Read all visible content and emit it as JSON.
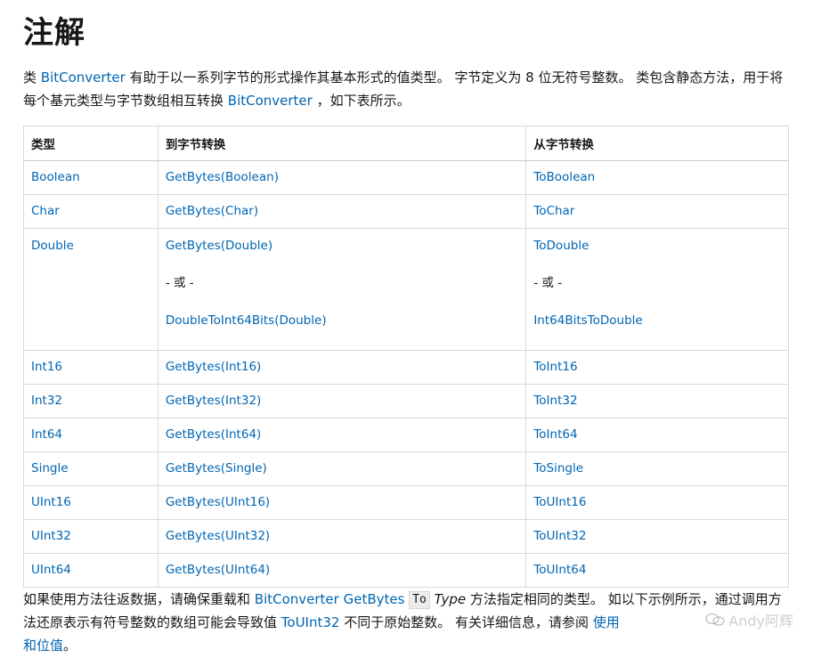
{
  "heading": "注解",
  "intro": {
    "t1": "类 ",
    "link1": "BitConverter",
    "t2": " 有助于以一系列字节的形式操作其基本形式的值类型。 字节定义为 8 位无符号整数。 类包含静态方法，用于将每个基元类型与字节数组相互转换 ",
    "link2": "BitConverter",
    "t3": " ，如下表所示。"
  },
  "table": {
    "headers": [
      "类型",
      "到字节转换",
      "从字节转换"
    ],
    "rows": [
      {
        "type": "Boolean",
        "to": "GetBytes(Boolean)",
        "from": "ToBoolean"
      },
      {
        "type": "Char",
        "to": "GetBytes(Char)",
        "from": "ToChar"
      },
      {
        "type": "Double",
        "to": "GetBytes(Double)",
        "or_to": "- 或 -",
        "to2": "DoubleToInt64Bits(Double)",
        "from": "ToDouble",
        "or_from": "- 或 -",
        "from2": "Int64BitsToDouble"
      },
      {
        "type": "Int16",
        "to": "GetBytes(Int16)",
        "from": "ToInt16"
      },
      {
        "type": "Int32",
        "to": "GetBytes(Int32)",
        "from": "ToInt32"
      },
      {
        "type": "Int64",
        "to": "GetBytes(Int64)",
        "from": "ToInt64"
      },
      {
        "type": "Single",
        "to": "GetBytes(Single)",
        "from": "ToSingle"
      },
      {
        "type": "UInt16",
        "to": "GetBytes(UInt16)",
        "from": "ToUInt16"
      },
      {
        "type": "UInt32",
        "to": "GetBytes(UInt32)",
        "from": "ToUInt32"
      },
      {
        "type": "UInt64",
        "to": "GetBytes(UInt64)",
        "from": "ToUInt64"
      }
    ]
  },
  "footer": {
    "t1": "如果使用方法往返数据，请确保重载和 ",
    "link1": "BitConverter",
    "link2": "GetBytes",
    "code": "To",
    "ital": "Type",
    "t2": " 方法指定相同的类型。 如以下示例所示，通过调用方法还原表示有符号整数的数组可能会导致值 ",
    "link3": "ToUInt32",
    "t3": " 不同于原始整数。 有关详细信息，请参阅 ",
    "link4": "使用",
    "link5": "和位值",
    "t4": "。"
  },
  "watermark": {
    "text": "Andy阿辉",
    "icon": "wechat-icon"
  },
  "colors": {
    "link": "#0065b3",
    "border": "#d9d9d9",
    "text": "#171717"
  }
}
